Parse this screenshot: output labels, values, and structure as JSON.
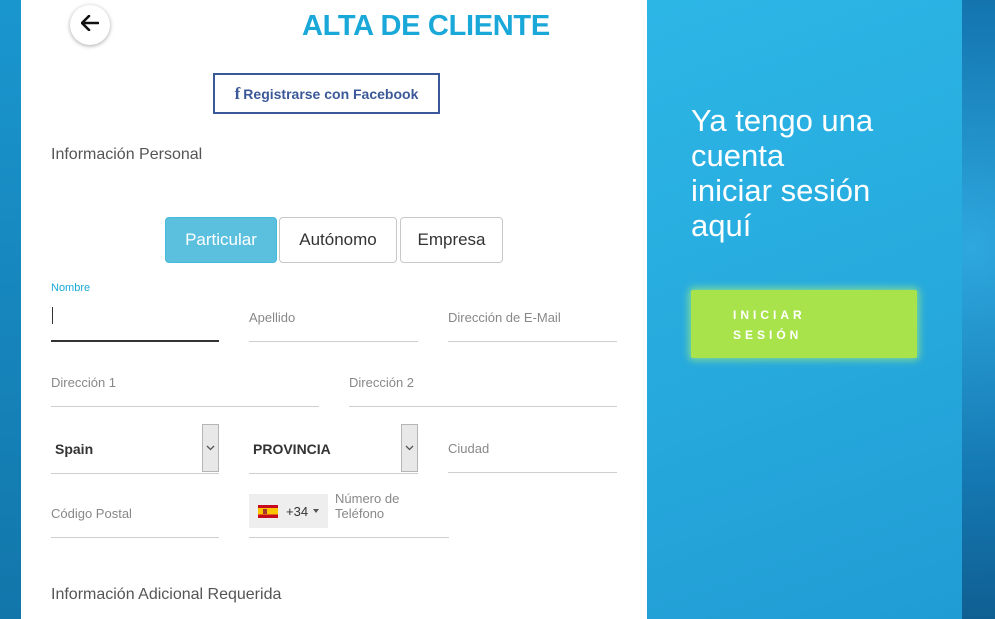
{
  "header": {
    "title": "ALTA DE CLIENTE",
    "back_icon": "arrow-left-icon"
  },
  "facebook": {
    "icon": "facebook-icon",
    "icon_glyph": "f",
    "label": "Registrarse con Facebook",
    "color": "#3b5998"
  },
  "sections": {
    "personal": "Información Personal",
    "additional": "Información Adicional Requerida"
  },
  "customer_type": {
    "options": [
      "Particular",
      "Autónomo",
      "Empresa"
    ],
    "selected": "Particular"
  },
  "fields": {
    "nombre": {
      "label": "Nombre",
      "value": ""
    },
    "apellido": {
      "placeholder": "Apellido"
    },
    "email": {
      "placeholder": "Dirección de E-Mail"
    },
    "direccion1": {
      "placeholder": "Dirección 1"
    },
    "direccion2": {
      "placeholder": "Dirección 2"
    },
    "country": {
      "value": "Spain"
    },
    "province": {
      "value": "PROVINCIA"
    },
    "ciudad": {
      "placeholder": "Ciudad"
    },
    "codigo_postal": {
      "placeholder": "Código Postal"
    },
    "phone": {
      "dial_code": "+34",
      "flag": "spain-flag-icon",
      "placeholder": "Número de Teléfono"
    }
  },
  "login": {
    "lines": [
      "Ya tengo una",
      "cuenta",
      "iniciar sesión",
      "aquí"
    ],
    "button_lines": [
      "INICIAR",
      "SESIÓN"
    ],
    "button_color": "#a9e34b"
  },
  "colors": {
    "accent": "#1aa8d9",
    "selected_segment": "#5bc0de",
    "login_panel": "#26a8dc"
  }
}
